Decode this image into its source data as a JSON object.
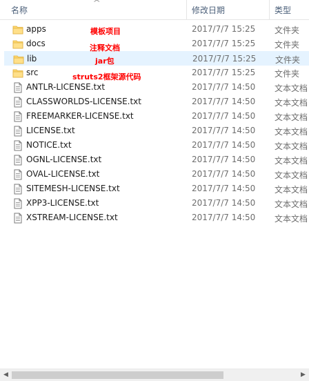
{
  "header": {
    "name_label": "名称",
    "date_label": "修改日期",
    "type_label": "类型",
    "sort_indicator": "^"
  },
  "files": [
    {
      "name": "apps",
      "date": "2017/7/7 15:25",
      "type": "文件夹",
      "kind": "folder"
    },
    {
      "name": "docs",
      "date": "2017/7/7 15:25",
      "type": "文件夹",
      "kind": "folder"
    },
    {
      "name": "lib",
      "date": "2017/7/7 15:25",
      "type": "文件夹",
      "kind": "folder",
      "selected": true
    },
    {
      "name": "src",
      "date": "2017/7/7 15:25",
      "type": "文件夹",
      "kind": "folder"
    },
    {
      "name": "ANTLR-LICENSE.txt",
      "date": "2017/7/7 14:50",
      "type": "文本文档",
      "kind": "text"
    },
    {
      "name": "CLASSWORLDS-LICENSE.txt",
      "date": "2017/7/7 14:50",
      "type": "文本文档",
      "kind": "text"
    },
    {
      "name": "FREEMARKER-LICENSE.txt",
      "date": "2017/7/7 14:50",
      "type": "文本文档",
      "kind": "text"
    },
    {
      "name": "LICENSE.txt",
      "date": "2017/7/7 14:50",
      "type": "文本文档",
      "kind": "text"
    },
    {
      "name": "NOTICE.txt",
      "date": "2017/7/7 14:50",
      "type": "文本文档",
      "kind": "text"
    },
    {
      "name": "OGNL-LICENSE.txt",
      "date": "2017/7/7 14:50",
      "type": "文本文档",
      "kind": "text"
    },
    {
      "name": "OVAL-LICENSE.txt",
      "date": "2017/7/7 14:50",
      "type": "文本文档",
      "kind": "text"
    },
    {
      "name": "SITEMESH-LICENSE.txt",
      "date": "2017/7/7 14:50",
      "type": "文本文档",
      "kind": "text"
    },
    {
      "name": "XPP3-LICENSE.txt",
      "date": "2017/7/7 14:50",
      "type": "文本文档",
      "kind": "text"
    },
    {
      "name": "XSTREAM-LICENSE.txt",
      "date": "2017/7/7 14:50",
      "type": "文本文档",
      "kind": "text"
    }
  ],
  "annotations": {
    "apps": "模板项目",
    "docs": "注释文档",
    "lib": "jar包",
    "src": "struts2框架源代码"
  },
  "colors": {
    "selected_row": "#e5f3ff",
    "folder": "#ffd86e",
    "annotation": "#ff0000",
    "header_text": "#4c607a"
  },
  "icons": {
    "folder": "folder-icon",
    "text": "text-file-icon",
    "sort": "sort-up-icon",
    "scroll_left": "scroll-left-arrow-icon",
    "scroll_right": "scroll-right-arrow-icon"
  }
}
